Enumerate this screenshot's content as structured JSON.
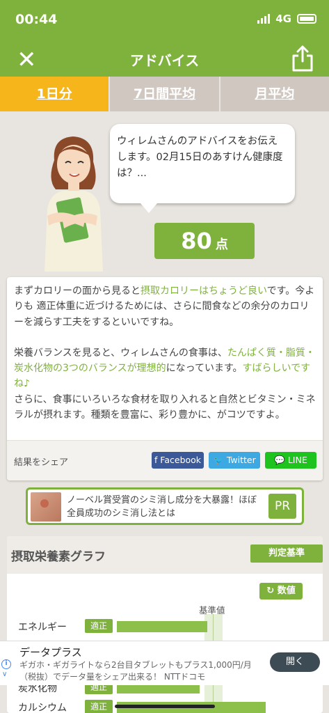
{
  "status": {
    "time": "00:44",
    "network": "4G"
  },
  "nav": {
    "close_label": "✕",
    "title": "アドバイス"
  },
  "tabs": [
    {
      "label": "1日分"
    },
    {
      "label": "7日間平均"
    },
    {
      "label": "月平均"
    }
  ],
  "bubble": {
    "text": "ウィレムさんのアドバイスをお伝えします。02月15日のあすけん健康度は？..."
  },
  "score": {
    "value": "80",
    "unit": "点"
  },
  "advice": {
    "p1_a": "まずカロリーの面から見ると",
    "p1_hl": "摂取カロリーはちょうど良い",
    "p1_b": "です。今よりも 適正体重に近づけるためには、さらに間食などの余分のカロリーを減らす工夫をするといいですね。",
    "p2_a": "栄養バランスを見ると、ウィレムさんの食事は、",
    "p2_hl": "たんぱく質・脂質・炭水化物の3つのバランスが理想的",
    "p2_b": "になっています。",
    "p2_hl2": "すばらしいですね♪",
    "p3": "さらに、食事にいろいろな食材を取り入れると自然とビタミン・ミネラルが摂れます。種類を豊富に、彩り豊かに、がコツですよ。"
  },
  "share": {
    "label": "結果をシェア",
    "facebook": "f Facebook",
    "twitter": "Twitter",
    "line": "LINE"
  },
  "pr": {
    "text": "ノーベル賞受賞のシミ消し成分を大暴露！ほぼ全員成功のシミ消し法とは",
    "badge": "PR"
  },
  "graph": {
    "title": "摂取栄養素グラフ",
    "criteria_button": "判定基準",
    "values_button": "数値",
    "baseline_label": "基準値",
    "rows": [
      {
        "name": "エネルギー",
        "tag": "適正",
        "level": 0.94
      },
      {
        "name": "炭水化物",
        "tag": "適正",
        "level": 0.86
      },
      {
        "name": "カルシウム",
        "tag": "適正",
        "level": 1.55
      }
    ]
  },
  "ad": {
    "title": "データプラス",
    "desc": "ギガホ・ギガライトなら2台目タブレットもプラス1,000円/月（税抜）でデータ量をシェア出来る！ NTTドコモ",
    "open": "開く"
  },
  "colors": {
    "brand_green": "#7fb23d",
    "tab_active": "#f5b51b",
    "facebook": "#3b5998",
    "twitter": "#3ea8e3",
    "line": "#1ec31e"
  }
}
